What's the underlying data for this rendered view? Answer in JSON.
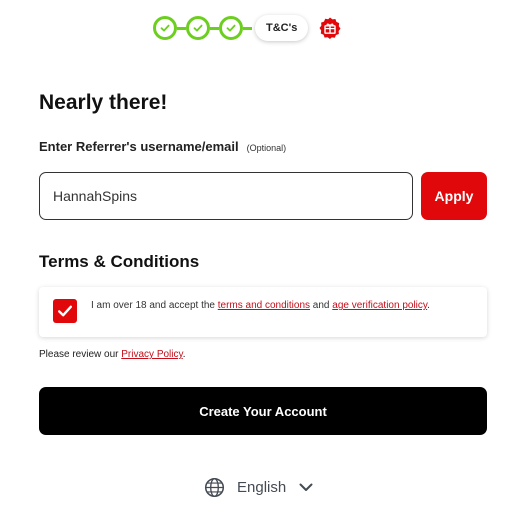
{
  "stepper": {
    "completed_steps": 3,
    "current_label": "T&C's",
    "accent_color": "#6ccf1f",
    "gift_color": "#e0080b",
    "icons": {
      "done": "check-icon",
      "final": "gift-icon"
    }
  },
  "form": {
    "title": "Nearly there!",
    "referrer": {
      "label": "Enter Referrer's username/email",
      "optional": "(Optional)",
      "value": "HannahSpins",
      "apply_label": "Apply"
    },
    "terms": {
      "heading": "Terms & Conditions",
      "checked": true,
      "text_before": "I am over 18 and accept the ",
      "link1": "terms and conditions",
      "text_middle": " and ",
      "link2": "age verification policy",
      "text_after": "."
    },
    "privacy": {
      "text_before": "Please review our ",
      "link": "Privacy Policy",
      "text_after": "."
    },
    "submit_label": "Create Your Account"
  },
  "language": {
    "label": "English",
    "icons": {
      "globe": "globe-icon",
      "chevron": "chevron-down-icon"
    }
  },
  "colors": {
    "brand_red": "#e0080b",
    "link_red": "#c40e1a",
    "button_black": "#000000"
  }
}
